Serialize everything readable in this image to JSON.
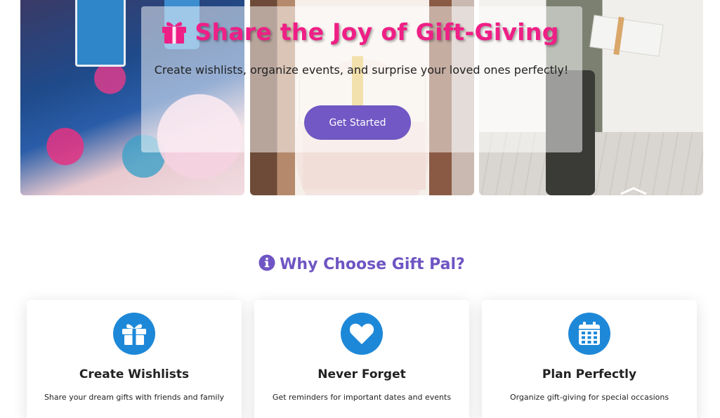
{
  "hero": {
    "title": "Share the Joy of Gift-Giving",
    "subtitle": "Create wishlists, organize events, and surprise your loved ones perfectly!",
    "cta_label": "Get Started",
    "title_color": "#ef1f86",
    "cta_color": "#7158c4"
  },
  "features": {
    "heading": "Why Choose Gift Pal?",
    "heading_color": "#6f55c3",
    "icon_bg": "#1e88d8",
    "cards": [
      {
        "icon": "gift-icon",
        "title": "Create Wishlists",
        "description": "Share your dream gifts with friends and family"
      },
      {
        "icon": "heart-icon",
        "title": "Never Forget",
        "description": "Get reminders for important dates and events"
      },
      {
        "icon": "calendar-icon",
        "title": "Plan Perfectly",
        "description": "Organize gift-giving for special occasions"
      }
    ]
  }
}
